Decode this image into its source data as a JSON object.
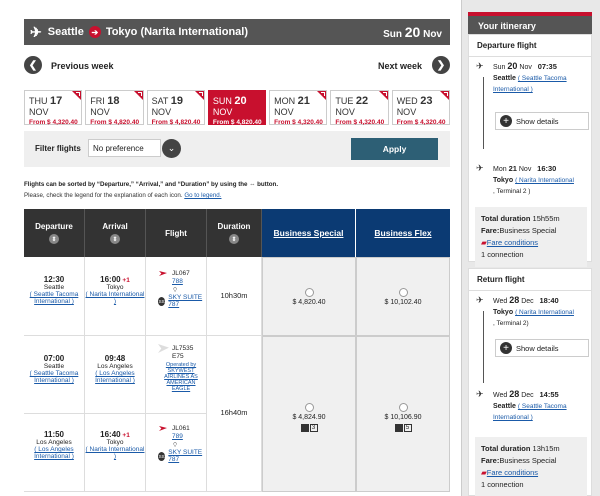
{
  "route": {
    "from": "Seattle",
    "to": "Tokyo (Narita International)",
    "day": "Sun",
    "date": "20",
    "month": "Nov"
  },
  "nav": {
    "prev": "Previous week",
    "next": "Next week"
  },
  "days": [
    {
      "dow": "THU",
      "d": "17",
      "m": "NOV",
      "price": "From $ 4,320.40",
      "selected": false
    },
    {
      "dow": "FRI",
      "d": "18",
      "m": "NOV",
      "price": "From $ 4,820.40",
      "selected": false
    },
    {
      "dow": "SAT",
      "d": "19",
      "m": "NOV",
      "price": "From $ 4,820.40",
      "selected": false
    },
    {
      "dow": "SUN",
      "d": "20",
      "m": "NOV",
      "price": "From $ 4,820.40",
      "selected": true
    },
    {
      "dow": "MON",
      "d": "21",
      "m": "NOV",
      "price": "From $ 4,320.40",
      "selected": false
    },
    {
      "dow": "TUE",
      "d": "22",
      "m": "NOV",
      "price": "From $ 4,320.40",
      "selected": false
    },
    {
      "dow": "WED",
      "d": "23",
      "m": "NOV",
      "price": "From $ 4,320.40",
      "selected": false
    }
  ],
  "filter": {
    "label": "Filter flights",
    "value": "No preference",
    "apply": "Apply"
  },
  "notes": {
    "sort": "Flights can be sorted by “Departure,” “Arrival,” and “Duration” by using the ⇔ button.",
    "legend": "Please, check the legend for the explanation of each icon.",
    "legend_link": "Go to legend."
  },
  "headers": {
    "dep": "Departure",
    "arr": "Arrival",
    "flight": "Flight",
    "dur": "Duration",
    "bs": "Business Special",
    "bf": "Business Flex"
  },
  "rows": {
    "r1": {
      "dep_t": "12:30",
      "dep_c": "Seattle",
      "dep_a": "( Seattle Tacoma International )",
      "arr_t": "16:00",
      "arr_plus": "+1",
      "arr_c": "Tokyo",
      "arr_a": "( Narita International )",
      "fno": "JL067",
      "ac": "788",
      "cabin": "SKY SUITE 787",
      "dur": "10h30m",
      "bs": "$ 4,820.40",
      "bf": "$ 10,102.40"
    },
    "r2": {
      "dep_t": "07:00",
      "dep_c": "Seattle",
      "dep_a": "( Seattle Tacoma International )",
      "arr_t": "09:48",
      "arr_c": "Los Angeles",
      "arr_a": "( Los Angeles International )",
      "fno": "JL7535",
      "ac": "E75",
      "op": "Operated by SKYWEST AIRLINES AS AMERICAN EAGLE",
      "dur": "16h40m",
      "bs": "$ 4,824.90",
      "bs_seats": "3",
      "bf": "$ 10,106.90",
      "bf_seats": "5"
    },
    "r3": {
      "dep_t": "11:50",
      "dep_c": "Los Angeles",
      "dep_a": "( Los Angeles International )",
      "arr_t": "16:40",
      "arr_plus": "+1",
      "arr_c": "Tokyo",
      "arr_a": "( Narita International )",
      "fno": "JL061",
      "ac": "789",
      "cabin": "SKY SUITE 787"
    }
  },
  "itin": {
    "title": "Your itinerary",
    "dep": {
      "title": "Departure flight",
      "d1": "Sun",
      "n1": "20",
      "m1": "Nov",
      "t1": "07:35",
      "c1": "Seattle",
      "a1": "( Seattle Tacoma International )",
      "show": "Show details",
      "d2": "Mon",
      "n2": "21",
      "m2": "Nov",
      "t2": "16:30",
      "c2": "Tokyo",
      "a2": "( Narita International",
      "term": ", Terminal  2 )",
      "total_l": "Total duration",
      "total_v": "15h55m",
      "fare_l": "Fare:",
      "fare_v": "Business Special",
      "cond": "Fare conditions",
      "conn": "1 connection"
    },
    "ret": {
      "title": "Return flight",
      "d1": "Wed",
      "n1": "28",
      "m1": "Dec",
      "t1": "18:40",
      "c1": "Tokyo",
      "a1": "( Narita International",
      "term": ", Terminal  2)",
      "show": "Show details",
      "d2": "Wed",
      "n2": "28",
      "m2": "Dec",
      "t2": "14:55",
      "c2": "Seattle",
      "a2": "( Seattle Tacoma International )",
      "total_l": "Total duration",
      "total_v": "13h15m",
      "fare_l": "Fare:",
      "fare_v": "Business Special",
      "cond": "Fare conditions",
      "conn": "1 connection"
    }
  }
}
